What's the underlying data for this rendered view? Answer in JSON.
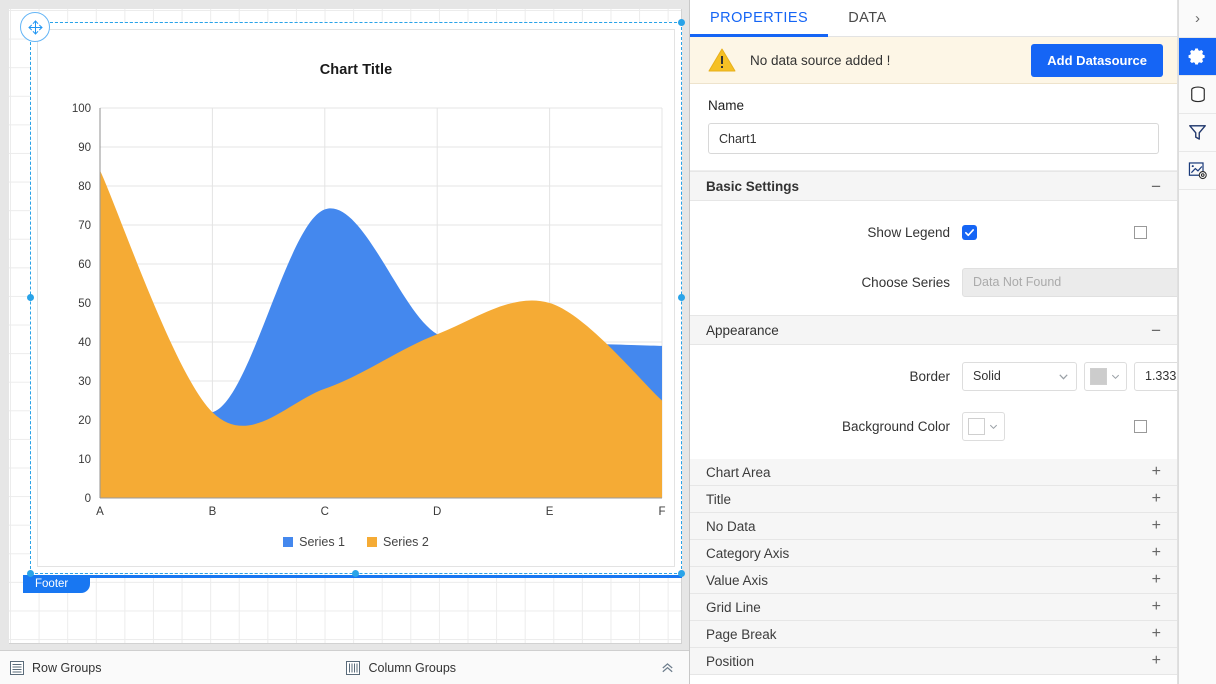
{
  "designer": {
    "chart_item_name": "Chart1 report item",
    "footer_label": "Footer",
    "groups_bar": {
      "row_groups_label": "Row Groups",
      "column_groups_label": "Column Groups",
      "row_groups_icon": "rows-icon",
      "column_groups_icon": "columns-icon",
      "collapse_icon": "chevron-double-up-icon"
    }
  },
  "chart_data": {
    "type": "area",
    "title": "Chart Title",
    "subtitle": "",
    "xlabel": "",
    "ylabel": "",
    "categories": [
      "A",
      "B",
      "C",
      "D",
      "E",
      "F"
    ],
    "ylim": [
      0,
      100
    ],
    "ytick_step": 10,
    "yticks": [
      0,
      10,
      20,
      30,
      40,
      50,
      60,
      70,
      80,
      90,
      100
    ],
    "grid": true,
    "legend_position": "bottom",
    "series": [
      {
        "name": "Series 1",
        "color": "#4488ee",
        "values": [
          59,
          22,
          74,
          42,
          40,
          39
        ]
      },
      {
        "name": "Series 2",
        "color": "#f5ab35",
        "values": [
          84,
          22,
          28,
          42,
          50,
          25
        ]
      }
    ]
  },
  "properties": {
    "tabs": [
      {
        "label": "PROPERTIES",
        "active": true
      },
      {
        "label": "DATA",
        "active": false
      }
    ],
    "datasource_banner": {
      "message": "No data source added !",
      "button_label": "Add Datasource",
      "warning_icon": "warning-triangle-icon"
    },
    "name": {
      "label": "Name",
      "value": "Chart1",
      "placeholder": "Name"
    },
    "basic_settings": {
      "title": "Basic Settings",
      "sign": "−",
      "show_legend": {
        "label": "Show Legend",
        "checked": true
      },
      "choose_series": {
        "label": "Choose Series",
        "value": "Data Not Found",
        "disabled": true,
        "edit_icon": "pencil-edit-icon"
      }
    },
    "appearance": {
      "title": "Appearance",
      "sign": "−",
      "border": {
        "label": "Border",
        "style_value": "Solid",
        "color_value": "#cccccc",
        "width_value": "1.333"
      },
      "background_color": {
        "label": "Background Color",
        "color_value": "#ffffff"
      }
    },
    "collapsed_sections": [
      {
        "label": "Chart Area",
        "sign": "+"
      },
      {
        "label": "Title",
        "sign": "+"
      },
      {
        "label": "No Data",
        "sign": "+"
      },
      {
        "label": "Category Axis",
        "sign": "+"
      },
      {
        "label": "Value Axis",
        "sign": "+"
      },
      {
        "label": "Grid Line",
        "sign": "+"
      },
      {
        "label": "Page Break",
        "sign": "+"
      },
      {
        "label": "Position",
        "sign": "+"
      }
    ]
  },
  "icon_rail": [
    {
      "name": "expand-panel-icon",
      "glyph": "›",
      "active": false
    },
    {
      "name": "settings-gear-icon",
      "glyph": "",
      "active": true
    },
    {
      "name": "data-database-icon",
      "glyph": "",
      "active": false
    },
    {
      "name": "filter-funnel-icon",
      "glyph": "",
      "active": false
    },
    {
      "name": "chart-settings-icon",
      "glyph": "",
      "active": false
    }
  ],
  "colors": {
    "accent": "#1565f5",
    "series1": "#4488ee",
    "series2": "#f5ab35",
    "warning": "#f5c025",
    "selection": "#29a3e8"
  }
}
